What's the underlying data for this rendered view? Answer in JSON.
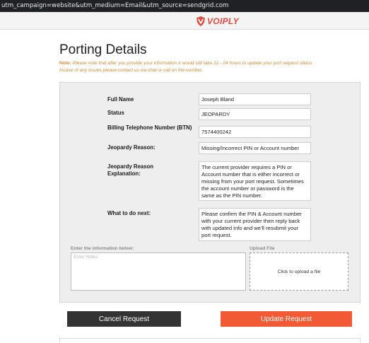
{
  "browser": {
    "url": "utm_campaign=website&utm_medium=Email&utm_source=sendgrid.com"
  },
  "header": {
    "logo_text": "VOIPLY",
    "logo_icon": "voiply-shield-logo",
    "brand_color": "#e2483d"
  },
  "page": {
    "title": "Porting Details",
    "note_label": "Note:",
    "note_text": " Please note that after you provide your information it would still take 12 - 24 hours to update your port request status.",
    "note_text2": "Incase of any issues please contact us via chat or call on the number."
  },
  "details": {
    "full_name_label": "Full Name",
    "full_name_value": "Joseph Bland",
    "status_label": "Status",
    "status_value": "JEOPARDY",
    "btn_label": "Billing Telephone Number (BTN)",
    "btn_value": "7574400242",
    "jeopardy_reason_label": "Jeopardy Reason:",
    "jeopardy_reason_value": "Missing/Incorrect PIN or Account number",
    "explanation_label": "Jeopardy Reason Explanation:",
    "explanation_value": "The current provider requires a PIN or Account number that is either incorrect or missing from your port request. Sometimes the account number or password is the same as the PIN number.",
    "next_label": "What to do next:",
    "next_value": "Please confirm the PIN & Account number with your current provider then reply back with updated info and we'll resubmit your port request."
  },
  "form": {
    "notes_label": "Enter the information below:",
    "notes_placeholder": "Enter Notes",
    "upload_label": "Upload File",
    "upload_text": "Click to upload a file"
  },
  "actions": {
    "cancel_label": "Cancel Request",
    "update_label": "Update Request",
    "cancel_color": "#333333",
    "update_color": "#f15a35"
  }
}
